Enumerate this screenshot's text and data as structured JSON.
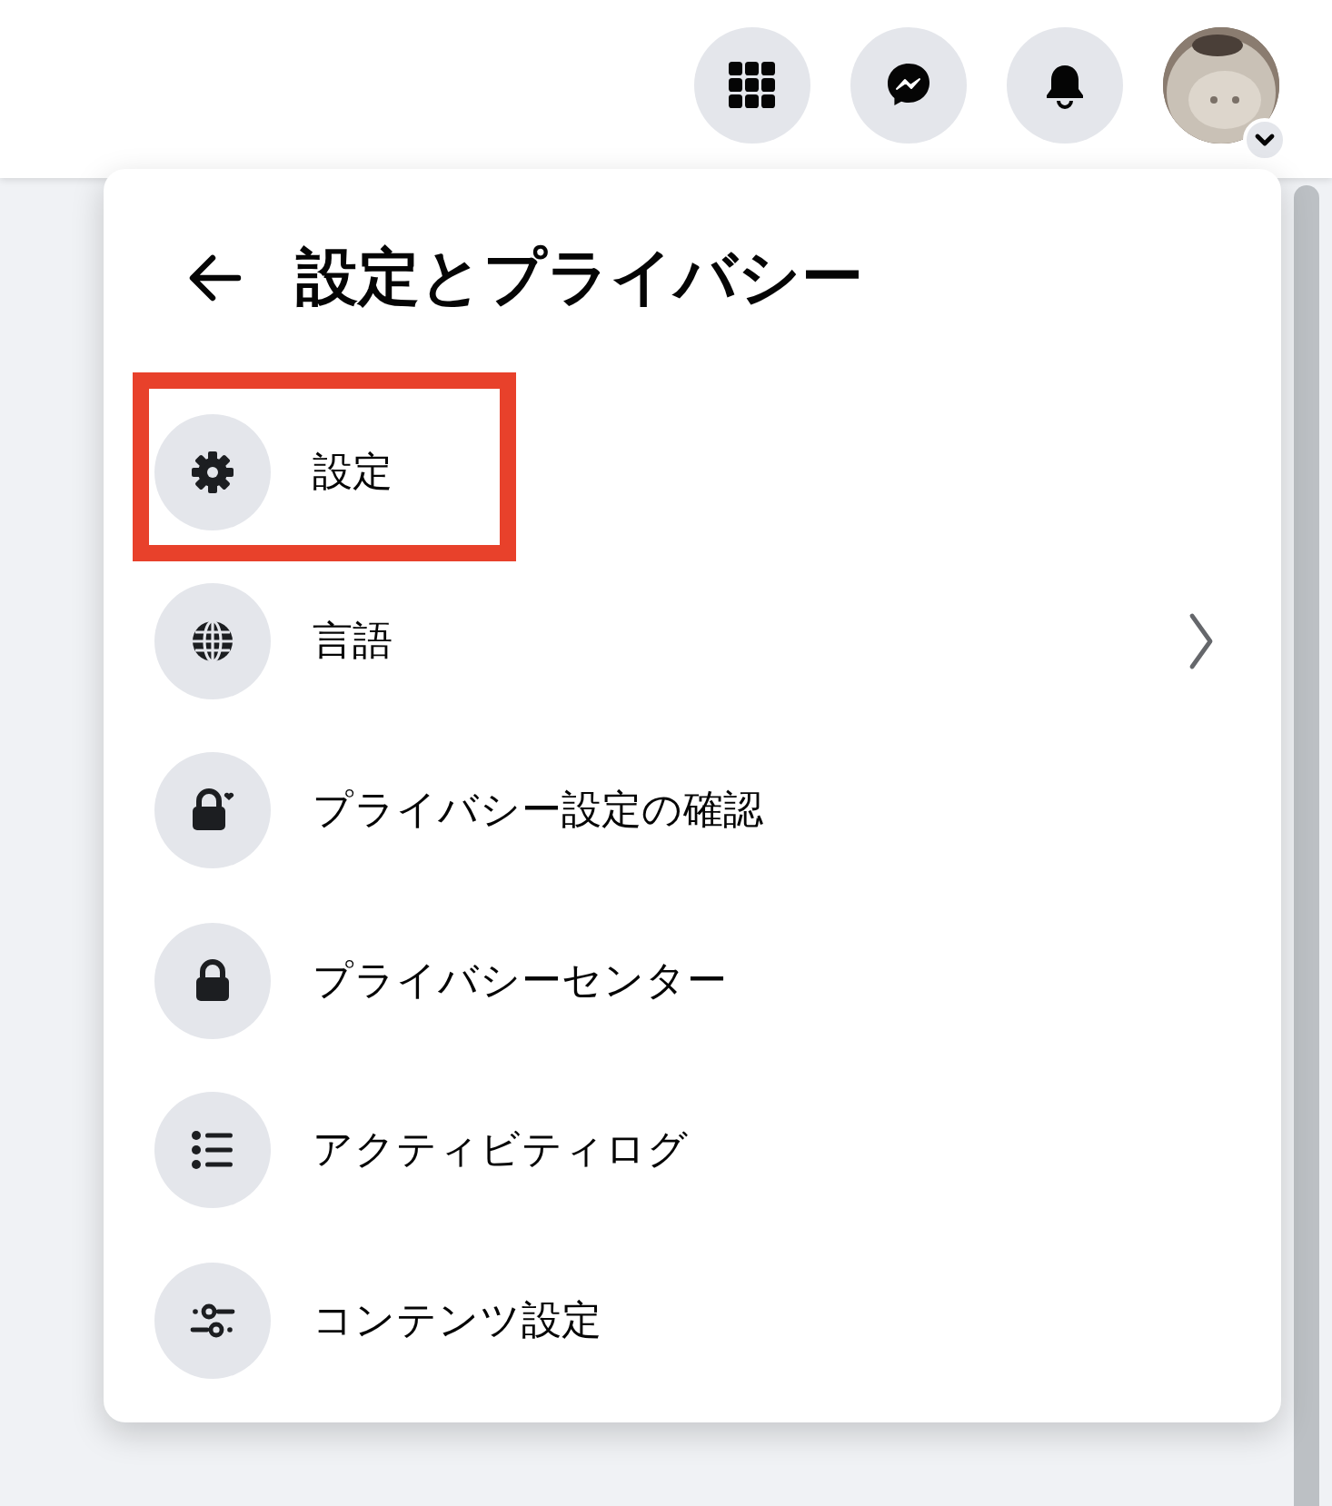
{
  "header": {
    "buttons": [
      {
        "kind": "grid"
      },
      {
        "kind": "messenger"
      },
      {
        "kind": "bell"
      },
      {
        "kind": "avatar"
      }
    ]
  },
  "menu": {
    "title": "設定とプライバシー",
    "items": [
      {
        "label": "設定",
        "kind": "gear",
        "has_submenu": false,
        "highlighted": true
      },
      {
        "label": "言語",
        "kind": "globe",
        "has_submenu": true,
        "highlighted": false
      },
      {
        "label": "プライバシー設定の確認",
        "kind": "lock-heart",
        "has_submenu": false,
        "highlighted": false
      },
      {
        "label": "プライバシーセンター",
        "kind": "lock",
        "has_submenu": false,
        "highlighted": false
      },
      {
        "label": "アクティビティログ",
        "kind": "list",
        "has_submenu": false,
        "highlighted": false
      },
      {
        "label": "コンテンツ設定",
        "kind": "sliders",
        "has_submenu": false,
        "highlighted": false
      }
    ]
  }
}
